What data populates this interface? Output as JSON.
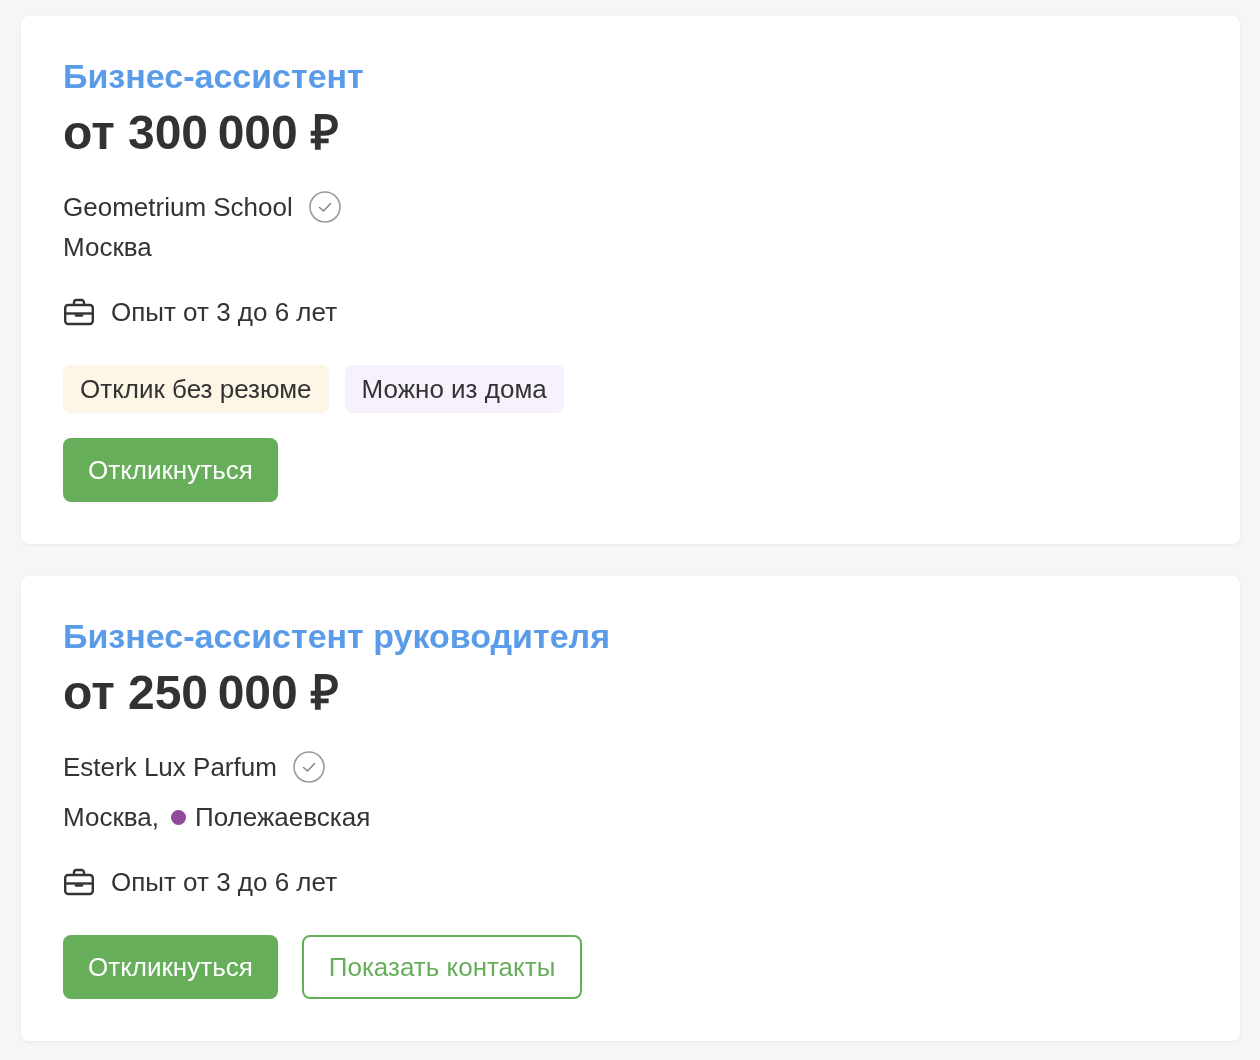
{
  "vacancies": [
    {
      "title": "Бизнес-ассистент",
      "salary": "от 300 000 ₽",
      "company": "Geometrium School",
      "verified": true,
      "location": {
        "city": "Москва"
      },
      "experience": "Опыт от 3 до 6 лет",
      "tags": [
        {
          "label": "Отклик без резюме",
          "color": "#fdf6e7"
        },
        {
          "label": "Можно из дома",
          "color": "#f7f0fd"
        }
      ],
      "buttons": [
        {
          "label": "Откликнуться",
          "kind": "primary"
        }
      ]
    },
    {
      "title": "Бизнес-ассистент руководителя",
      "salary": "от 250 000 ₽",
      "company": "Esterk Lux Parfum",
      "verified": true,
      "location": {
        "city": "Москва,",
        "metro": {
          "name": "Полежаевская",
          "color": "#8f4a99"
        }
      },
      "experience": "Опыт от 3 до 6 лет",
      "buttons": [
        {
          "label": "Откликнуться",
          "kind": "primary"
        },
        {
          "label": "Показать контакты",
          "kind": "outline"
        }
      ]
    }
  ]
}
